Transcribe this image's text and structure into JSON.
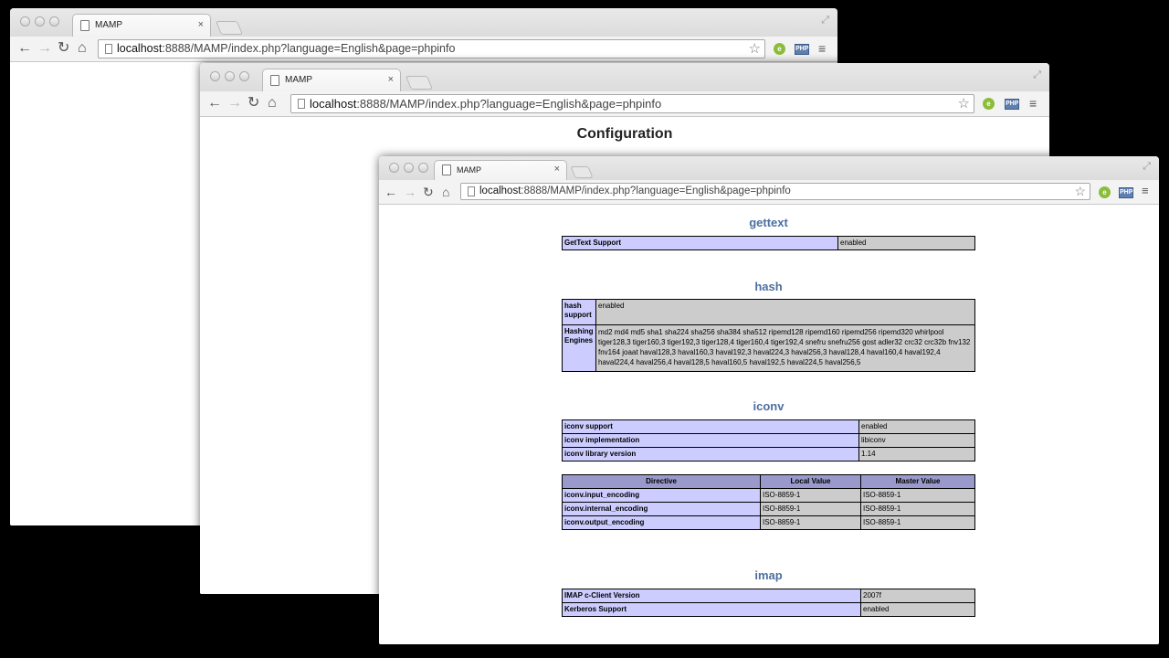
{
  "browser": {
    "tab_title": "MAMP",
    "close_glyph": "×",
    "url_host": "localhost",
    "url_rest": ":8888/MAMP/index.php?language=English&page=phpinfo",
    "nav": {
      "back": "←",
      "forward": "→",
      "reload": "↻",
      "home": "⌂"
    },
    "star_glyph": "☆",
    "menu_glyph": "≡",
    "ext1_text": "e",
    "ext2_text": "PHP",
    "fullscreen_glyph": "⤢"
  },
  "middle_page": {
    "title": "Configuration"
  },
  "front_page": {
    "gettext": {
      "heading": "gettext",
      "rows": [
        {
          "key": "GetText Support",
          "value": "enabled"
        }
      ]
    },
    "hash": {
      "heading": "hash",
      "rows": [
        {
          "key": "hash support",
          "value": "enabled"
        },
        {
          "key": "Hashing Engines",
          "value": "md2 md4 md5 sha1 sha224 sha256 sha384 sha512 ripemd128 ripemd160 ripemd256 ripemd320 whirlpool tiger128,3 tiger160,3 tiger192,3 tiger128,4 tiger160,4 tiger192,4 snefru snefru256 gost adler32 crc32 crc32b fnv132 fnv164 joaat haval128,3 haval160,3 haval192,3 haval224,3 haval256,3 haval128,4 haval160,4 haval192,4 haval224,4 haval256,4 haval128,5 haval160,5 haval192,5 haval224,5 haval256,5"
        }
      ]
    },
    "iconv": {
      "heading": "iconv",
      "rows": [
        {
          "key": "iconv support",
          "value": "enabled"
        },
        {
          "key": "iconv implementation",
          "value": "libiconv"
        },
        {
          "key": "iconv library version",
          "value": "1.14"
        }
      ],
      "directive_headers": [
        "Directive",
        "Local Value",
        "Master Value"
      ],
      "directives": [
        {
          "name": "iconv.input_encoding",
          "local": "ISO-8859-1",
          "master": "ISO-8859-1"
        },
        {
          "name": "iconv.internal_encoding",
          "local": "ISO-8859-1",
          "master": "ISO-8859-1"
        },
        {
          "name": "iconv.output_encoding",
          "local": "ISO-8859-1",
          "master": "ISO-8859-1"
        }
      ]
    },
    "imap": {
      "heading": "imap",
      "rows": [
        {
          "key": "IMAP c-Client Version",
          "value": "2007f"
        },
        {
          "key": "Kerberos Support",
          "value": "enabled"
        }
      ]
    }
  }
}
